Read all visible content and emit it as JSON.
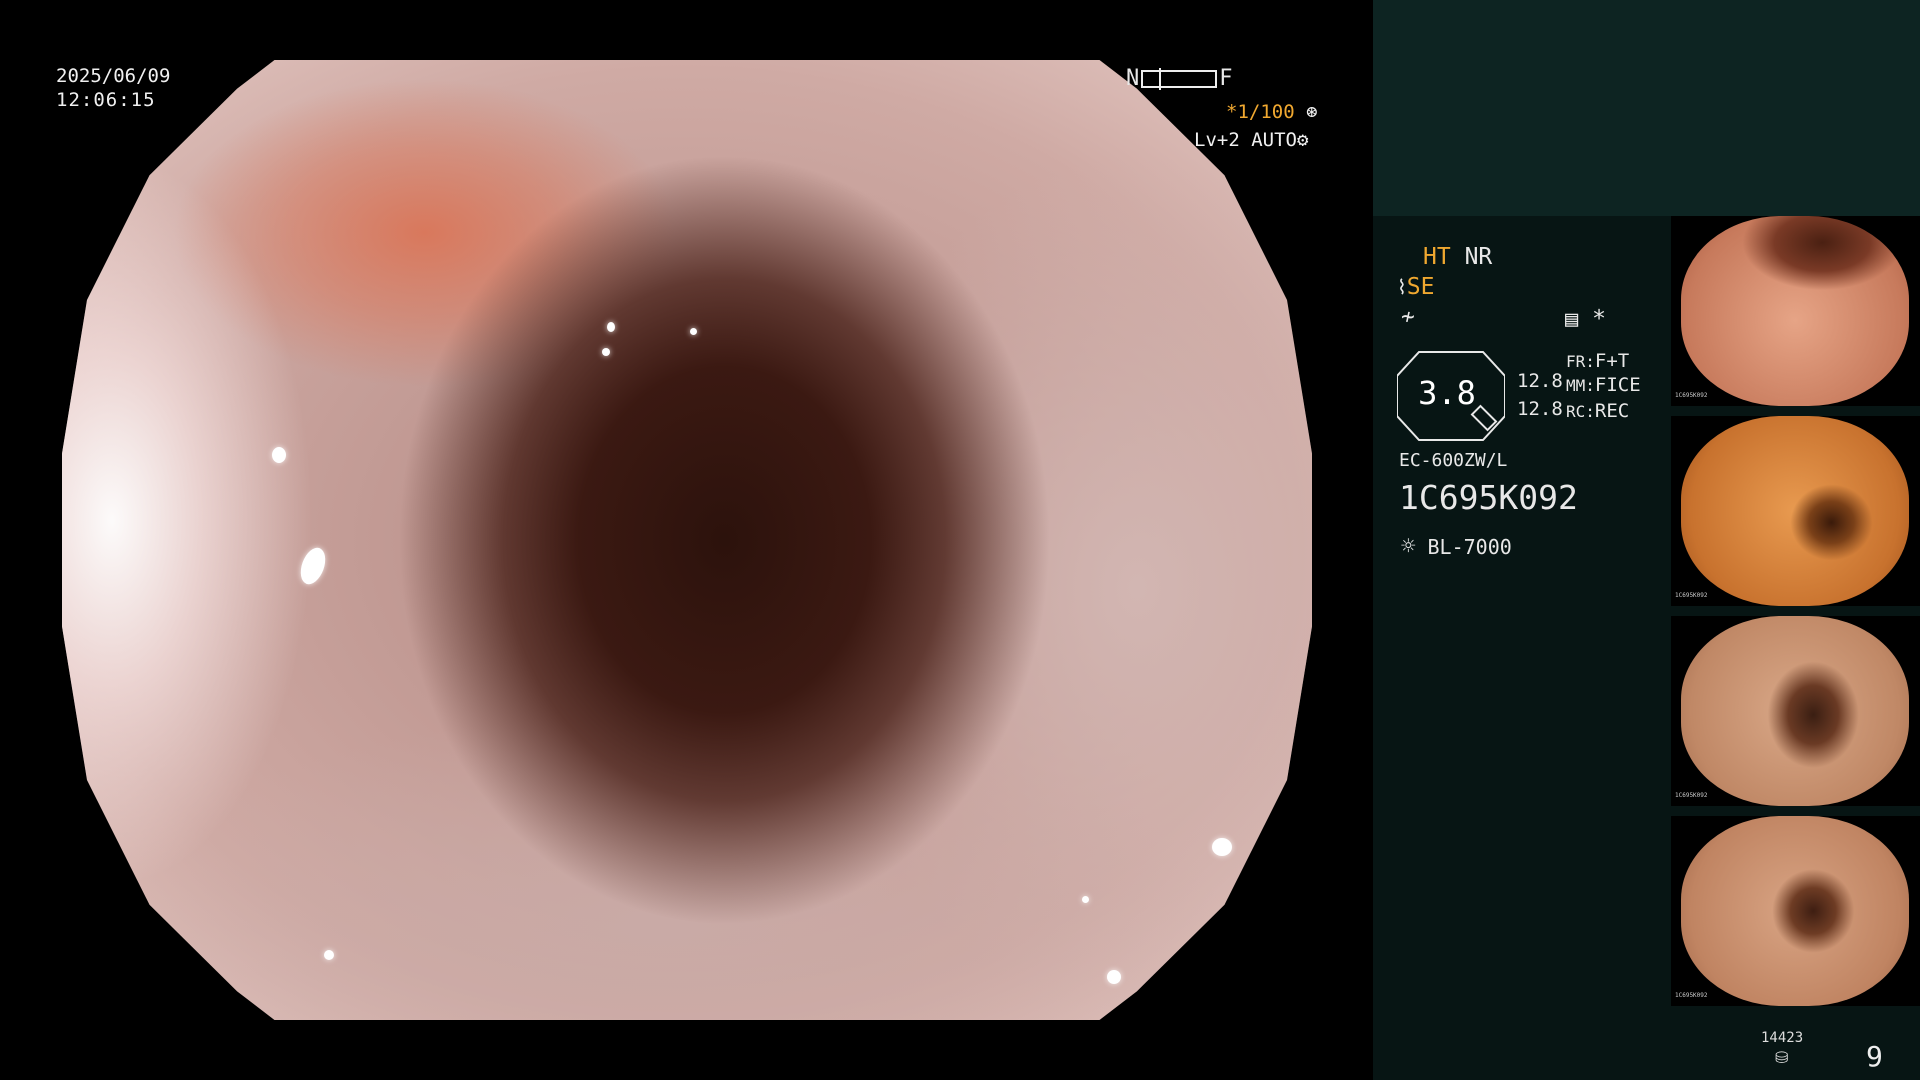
{
  "overlay": {
    "date": "2025/06/09",
    "time": "12:06:15",
    "scale_left": "N",
    "scale_right": "F",
    "shutter": "*1/100",
    "level": "Lv+2",
    "mode": "AUTO"
  },
  "panel": {
    "ht": "HT",
    "nr": "NR",
    "se": "SE",
    "star": "*",
    "zoom": "3.8",
    "fr_label": "FR:",
    "fr_value": "F+T",
    "mm_label": "MM:",
    "mm_value": "FICE",
    "rc_label": "RC:",
    "rc_value": "REC",
    "num1": "12.8",
    "num2": "12.8",
    "scope_model": "EC-600ZW/L",
    "serial": "1C695K092",
    "light_source": "BL-7000"
  },
  "thumbnails": [
    {
      "label": "1C695K092"
    },
    {
      "label": "1C695K092"
    },
    {
      "label": "1C695K092"
    },
    {
      "label": "1C695K092"
    }
  ],
  "footer": {
    "counter": "14423",
    "page": "9"
  },
  "icons": {
    "shutter": "shutter-icon",
    "mode": "gear-icon",
    "light": "sun-icon",
    "storage": "disk-icon"
  },
  "colors": {
    "accent": "#f0a830",
    "panel_bg": "#071514",
    "panel_top": "#0d2422"
  }
}
